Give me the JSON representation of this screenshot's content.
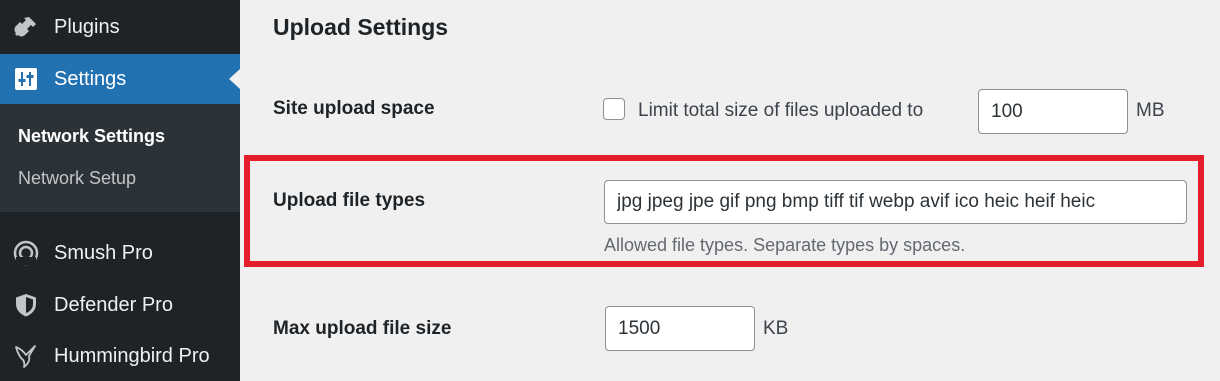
{
  "sidebar": {
    "items": [
      {
        "label": "Plugins",
        "icon": "plugin-icon"
      },
      {
        "label": "Settings",
        "icon": "settings-sliders-icon"
      },
      {
        "label": "Smush Pro",
        "icon": "smush-icon"
      },
      {
        "label": "Defender Pro",
        "icon": "shield-icon"
      },
      {
        "label": "Hummingbird Pro",
        "icon": "hummingbird-icon"
      }
    ],
    "submenu": [
      {
        "label": "Network Settings"
      },
      {
        "label": "Network Setup"
      }
    ]
  },
  "main": {
    "section_title": "Upload Settings",
    "site_upload_space": {
      "label": "Site upload space",
      "checkbox_checked": false,
      "checkbox_label": "Limit total size of files uploaded to",
      "value": "100",
      "unit": "MB"
    },
    "upload_file_types": {
      "label": "Upload file types",
      "value": "jpg jpeg jpe gif png bmp tiff tif webp avif ico heic heif heic",
      "help": "Allowed file types. Separate types by spaces."
    },
    "max_upload_file_size": {
      "label": "Max upload file size",
      "value": "1500",
      "unit": "KB"
    }
  },
  "colors": {
    "sidebar_bg": "#1d2327",
    "submenu_bg": "#2c3338",
    "active_menu_bg": "#2271b1",
    "highlight_border": "#e61d2b"
  }
}
